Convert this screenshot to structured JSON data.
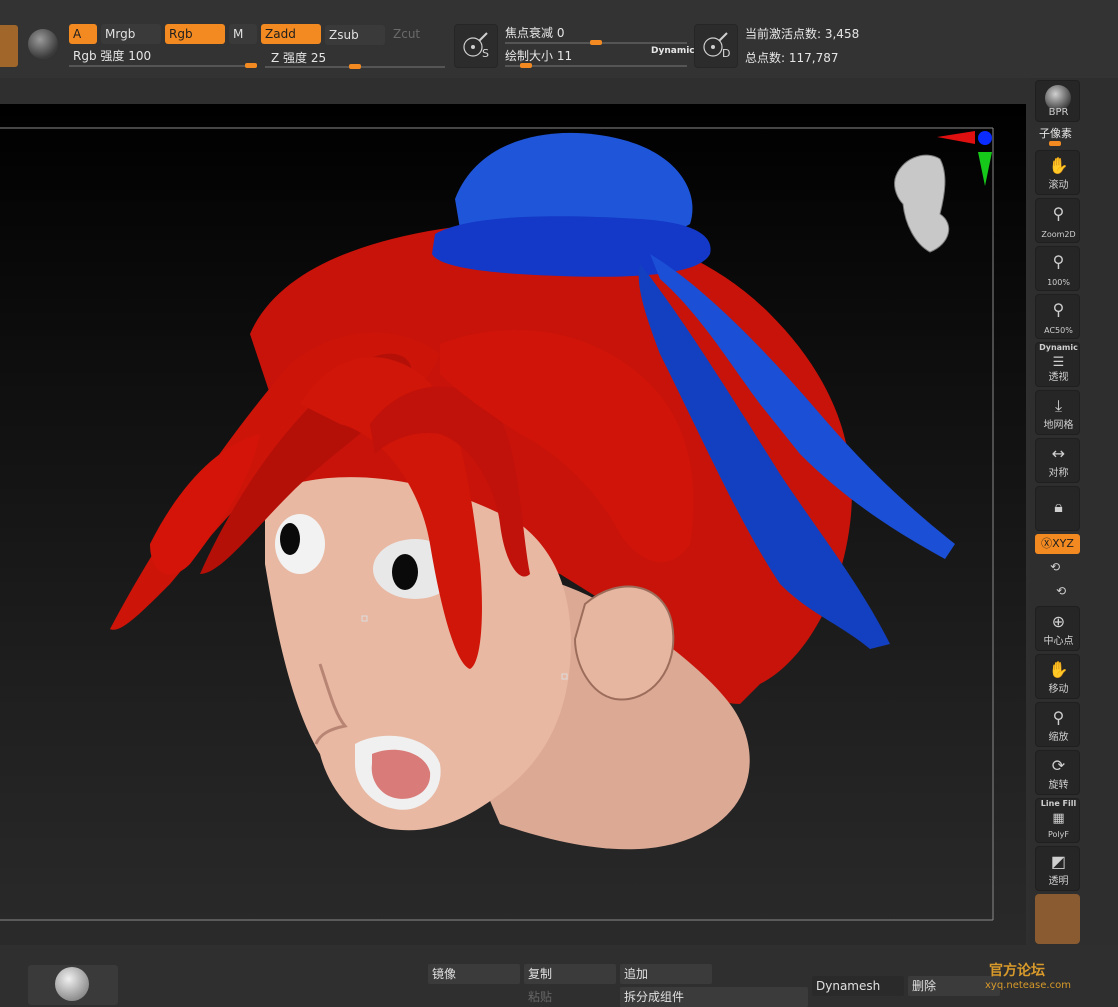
{
  "toolbar": {
    "a_label": "A",
    "mrgb_label": "Mrgb",
    "rgb_label": "Rgb",
    "m_label": "M",
    "zadd_label": "Zadd",
    "zsub_label": "Zsub",
    "zcut_label": "Zcut",
    "rgb_intensity_label": "Rgb 强度 100",
    "z_intensity_label": "Z 强度 25",
    "focal_shift_label": "焦点衰减 0",
    "draw_size_label": "绘制大小 11",
    "dynamic_label": "Dynamic",
    "s_label": "S",
    "d_label": "D",
    "active_points_label": "当前激活点数: 3,458",
    "total_points_label": "总点数: 117,787"
  },
  "right_tools": {
    "bpr": "BPR",
    "subpixel": "子像素",
    "scroll": "滚动",
    "zoom2d": "Zoom2D",
    "zoom100": "100%",
    "ac50": "AC50%",
    "dynamic": "Dynamic",
    "persp": "透视",
    "floor": "地网格",
    "symmetry": "对称",
    "xyz": "ⓍXYZ",
    "center": "中心点",
    "move": "移动",
    "scale": "缩放",
    "rotate": "旋转",
    "linefill": "Line Fill",
    "polyf": "PolyF",
    "transp": "透明"
  },
  "bottom": {
    "mirror": "镜像",
    "copy": "复制",
    "append": "追加",
    "paste": "粘贴",
    "split": "拆分成组件",
    "dynamesh": "Dynamesh",
    "delete": "删除"
  },
  "watermark": {
    "site": "xyq.netease.com",
    "slogan": "官方论坛"
  },
  "colors": {
    "accent": "#f28a21",
    "hair": "#d41408",
    "hat": "#1a4fd6",
    "skin": "#e8b8a2"
  }
}
